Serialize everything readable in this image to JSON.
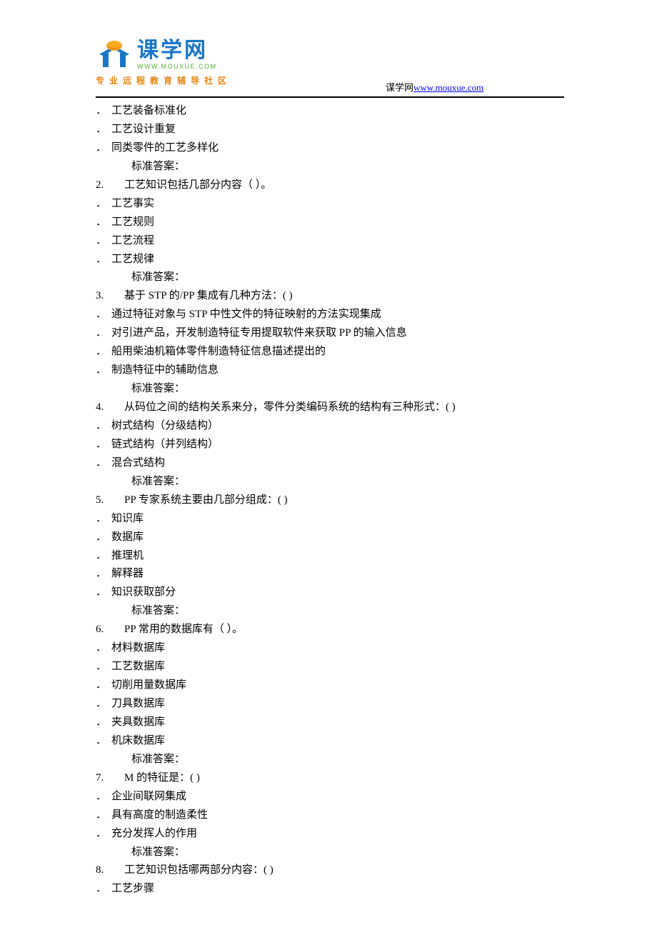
{
  "logo": {
    "cn": "课学网",
    "url": "WWW.MOUXUE.COM",
    "slogan": "专业远程教育辅导社区"
  },
  "header": {
    "site_name": "谋学网",
    "site_url": "www.mouxue.com"
  },
  "content_lines": [
    {
      "type": "option",
      "text": "工艺装备标准化"
    },
    {
      "type": "option",
      "text": "工艺设计重复"
    },
    {
      "type": "option",
      "text": "同类零件的工艺多样化"
    },
    {
      "type": "answer",
      "text": "标准答案："
    },
    {
      "type": "question",
      "num": "2.",
      "text": "工艺知识包括几部分内容（        ）。"
    },
    {
      "type": "option",
      "text": "工艺事实"
    },
    {
      "type": "option",
      "text": "工艺规则"
    },
    {
      "type": "option",
      "text": "工艺流程"
    },
    {
      "type": "option",
      "text": "工艺规律"
    },
    {
      "type": "answer",
      "text": "标准答案："
    },
    {
      "type": "question",
      "num": "3.",
      "text": "基于 STP 的/PP 集成有几种方法：(   )"
    },
    {
      "type": "option",
      "text": "通过特征对象与 STP 中性文件的特征映射的方法实现集成"
    },
    {
      "type": "option",
      "text": "对引进产品，开发制造特征专用提取软件来获取 PP 的输入信息"
    },
    {
      "type": "option",
      "text": "船用柴油机箱体零件制造特征信息描述提出的"
    },
    {
      "type": "option",
      "text": "制造特征中的辅助信息"
    },
    {
      "type": "answer",
      "text": "标准答案："
    },
    {
      "type": "question",
      "num": "4.",
      "text": "从码位之间的结构关系来分，零件分类编码系统的结构有三种形式：(   )"
    },
    {
      "type": "option",
      "text": "树式结构（分级结构）"
    },
    {
      "type": "option",
      "text": "链式结构（并列结构）"
    },
    {
      "type": "option",
      "text": "混合式结构"
    },
    {
      "type": "answer",
      "text": "标准答案："
    },
    {
      "type": "question",
      "num": "5.",
      "text": "PP 专家系统主要由几部分组成：(   )"
    },
    {
      "type": "option",
      "text": "知识库"
    },
    {
      "type": "option",
      "text": "数据库"
    },
    {
      "type": "option",
      "text": "推理机"
    },
    {
      "type": "option",
      "text": "解释器"
    },
    {
      "type": "option",
      "text": "知识获取部分"
    },
    {
      "type": "answer",
      "text": "标准答案："
    },
    {
      "type": "question",
      "num": "6.",
      "text": "PP 常用的数据库有（  ）。"
    },
    {
      "type": "option",
      "text": "材料数据库"
    },
    {
      "type": "option",
      "text": "工艺数据库"
    },
    {
      "type": "option",
      "text": "切削用量数据库"
    },
    {
      "type": "option",
      "text": "刀具数据库"
    },
    {
      "type": "option",
      "text": "夹具数据库"
    },
    {
      "type": "option",
      "text": "机床数据库"
    },
    {
      "type": "answer",
      "text": "标准答案："
    },
    {
      "type": "question",
      "num": "7.",
      "text": "M 的特征是：(   )"
    },
    {
      "type": "option",
      "text": "企业间联网集成"
    },
    {
      "type": "option",
      "text": "具有高度的制造柔性"
    },
    {
      "type": "option",
      "text": "充分发挥人的作用"
    },
    {
      "type": "answer",
      "text": "标准答案："
    },
    {
      "type": "question",
      "num": "8.",
      "text": "工艺知识包括哪两部分内容：(   )"
    },
    {
      "type": "option",
      "text": "工艺步骤"
    }
  ]
}
